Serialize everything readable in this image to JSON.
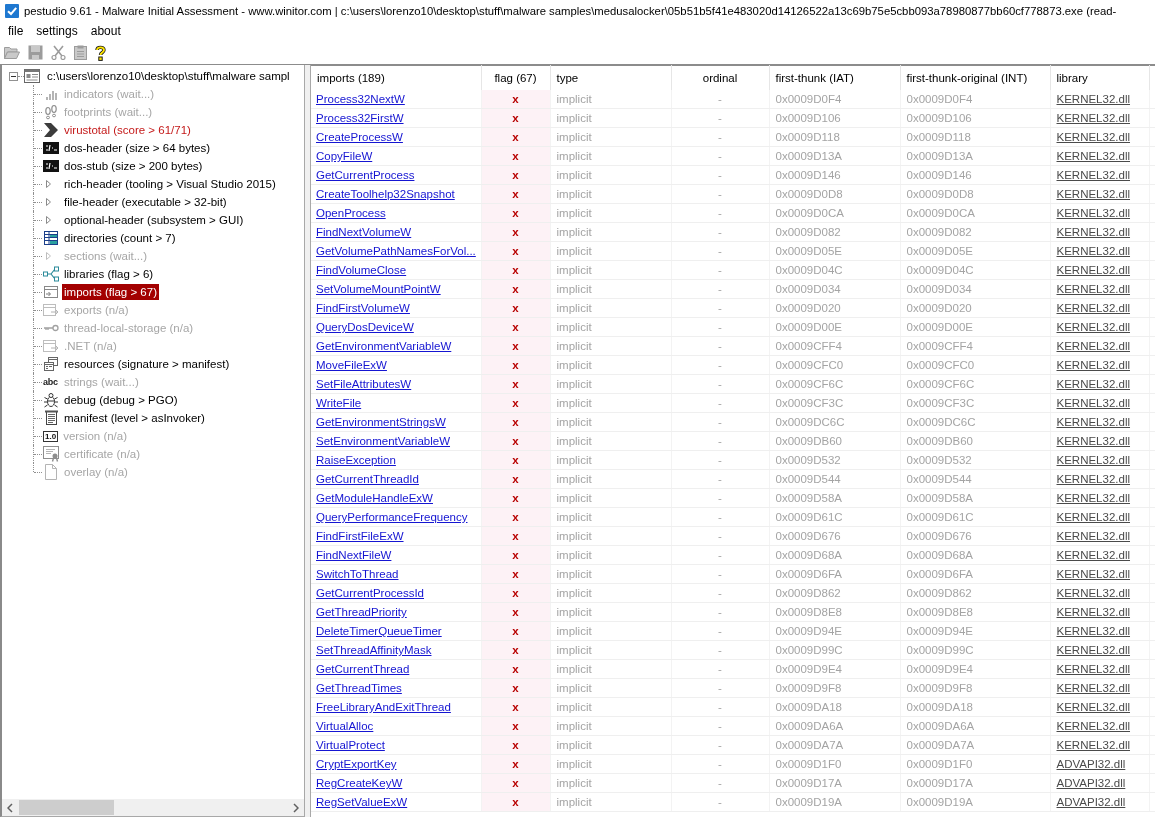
{
  "window": {
    "title": "pestudio 9.61 - Malware Initial Assessment - www.winitor.com | c:\\users\\lorenzo10\\desktop\\stuff\\malware samples\\medusalocker\\05b51b5f41e483020d14126522a13c69b75e5cbb093a78980877bb60cf778873.exe (read-"
  },
  "menu_bar": [
    {
      "label": "file"
    },
    {
      "label": "settings"
    },
    {
      "label": "about"
    }
  ],
  "toolbar": [
    {
      "kind": "open",
      "disabled": true
    },
    {
      "kind": "save",
      "disabled": true
    },
    {
      "kind": "cut",
      "disabled": true
    },
    {
      "kind": "clipboard",
      "disabled": true
    },
    {
      "kind": "help",
      "disabled": false
    }
  ],
  "tree": {
    "label": "c:\\users\\lorenzo10\\desktop\\stuff\\malware sampl",
    "expanded": true,
    "children": [
      {
        "label": "indicators (wait...)",
        "kind": "bars",
        "selected": false,
        "disabled": true,
        "flagged": false
      },
      {
        "label": "footprints (wait...)",
        "kind": "footprints",
        "selected": false,
        "disabled": true,
        "flagged": false
      },
      {
        "label": "virustotal (score > 61/71)",
        "kind": "chevron",
        "selected": false,
        "disabled": false,
        "flagged": true
      },
      {
        "label": "dos-header (size > 64 bytes)",
        "kind": "console",
        "selected": false,
        "disabled": false,
        "flagged": false
      },
      {
        "label": "dos-stub (size > 200 bytes)",
        "kind": "console",
        "selected": false,
        "disabled": false,
        "flagged": false
      },
      {
        "label": "rich-header (tooling > Visual Studio 2015)",
        "kind": "group",
        "expanded": false,
        "selected": false,
        "disabled": false,
        "flagged": false
      },
      {
        "label": "file-header (executable > 32-bit)",
        "kind": "group",
        "expanded": false,
        "selected": false,
        "disabled": false,
        "flagged": false
      },
      {
        "label": "optional-header (subsystem > GUI)",
        "kind": "group",
        "expanded": false,
        "selected": false,
        "disabled": false,
        "flagged": false
      },
      {
        "label": "directories (count > 7)",
        "kind": "grid",
        "selected": false,
        "disabled": false,
        "flagged": false
      },
      {
        "label": "sections (wait...)",
        "kind": "group",
        "expanded": false,
        "selected": false,
        "disabled": true,
        "flagged": false
      },
      {
        "label": "libraries (flag > 6)",
        "kind": "nodes",
        "selected": false,
        "disabled": false,
        "flagged": false
      },
      {
        "label": "imports (flag > 67)",
        "kind": "arrow-in",
        "selected": true,
        "disabled": false,
        "flagged": false
      },
      {
        "label": "exports (n/a)",
        "kind": "arrow-out",
        "selected": false,
        "disabled": true,
        "flagged": false
      },
      {
        "label": "thread-local-storage (n/a)",
        "kind": "key",
        "selected": false,
        "disabled": true,
        "flagged": false
      },
      {
        "label": ".NET (n/a)",
        "kind": "arrow-out",
        "selected": false,
        "disabled": true,
        "flagged": false
      },
      {
        "label": "resources (signature > manifest)",
        "kind": "windows",
        "selected": false,
        "disabled": false,
        "flagged": false
      },
      {
        "label": "strings (wait...)",
        "kind": "glyph",
        "glyph": "abc",
        "selected": false,
        "disabled": true,
        "flagged": false
      },
      {
        "label": "debug (debug > PGO)",
        "kind": "bug",
        "selected": false,
        "disabled": false,
        "flagged": false
      },
      {
        "label": "manifest (level > asInvoker)",
        "kind": "scroll",
        "selected": false,
        "disabled": false,
        "flagged": false
      },
      {
        "label": "version (n/a)",
        "kind": "tag",
        "glyph": "1.0",
        "selected": false,
        "disabled": true,
        "flagged": false
      },
      {
        "label": "certificate (n/a)",
        "kind": "certificate",
        "selected": false,
        "disabled": true,
        "flagged": false
      },
      {
        "label": "overlay (n/a)",
        "kind": "page",
        "selected": false,
        "disabled": true,
        "flagged": false
      }
    ]
  },
  "table": {
    "columns": [
      {
        "label": "imports (189)"
      },
      {
        "label": "flag (67)"
      },
      {
        "label": "type"
      },
      {
        "label": "ordinal"
      },
      {
        "label": "first-thunk (IAT)"
      },
      {
        "label": "first-thunk-original (INT)"
      },
      {
        "label": "library"
      }
    ],
    "rows": [
      {
        "name": "Process32NextW",
        "flag": "x",
        "type": "implicit",
        "ordinal": "-",
        "first_thunk": "0x0009D0F4",
        "first_thunk_original": "0x0009D0F4",
        "library": "KERNEL32.dll"
      },
      {
        "name": "Process32FirstW",
        "flag": "x",
        "type": "implicit",
        "ordinal": "-",
        "first_thunk": "0x0009D106",
        "first_thunk_original": "0x0009D106",
        "library": "KERNEL32.dll"
      },
      {
        "name": "CreateProcessW",
        "flag": "x",
        "type": "implicit",
        "ordinal": "-",
        "first_thunk": "0x0009D118",
        "first_thunk_original": "0x0009D118",
        "library": "KERNEL32.dll"
      },
      {
        "name": "CopyFileW",
        "flag": "x",
        "type": "implicit",
        "ordinal": "-",
        "first_thunk": "0x0009D13A",
        "first_thunk_original": "0x0009D13A",
        "library": "KERNEL32.dll"
      },
      {
        "name": "GetCurrentProcess",
        "flag": "x",
        "type": "implicit",
        "ordinal": "-",
        "first_thunk": "0x0009D146",
        "first_thunk_original": "0x0009D146",
        "library": "KERNEL32.dll"
      },
      {
        "name": "CreateToolhelp32Snapshot",
        "flag": "x",
        "type": "implicit",
        "ordinal": "-",
        "first_thunk": "0x0009D0D8",
        "first_thunk_original": "0x0009D0D8",
        "library": "KERNEL32.dll"
      },
      {
        "name": "OpenProcess",
        "flag": "x",
        "type": "implicit",
        "ordinal": "-",
        "first_thunk": "0x0009D0CA",
        "first_thunk_original": "0x0009D0CA",
        "library": "KERNEL32.dll"
      },
      {
        "name": "FindNextVolumeW",
        "flag": "x",
        "type": "implicit",
        "ordinal": "-",
        "first_thunk": "0x0009D082",
        "first_thunk_original": "0x0009D082",
        "library": "KERNEL32.dll"
      },
      {
        "name": "GetVolumePathNamesForVol...",
        "flag": "x",
        "type": "implicit",
        "ordinal": "-",
        "first_thunk": "0x0009D05E",
        "first_thunk_original": "0x0009D05E",
        "library": "KERNEL32.dll"
      },
      {
        "name": "FindVolumeClose",
        "flag": "x",
        "type": "implicit",
        "ordinal": "-",
        "first_thunk": "0x0009D04C",
        "first_thunk_original": "0x0009D04C",
        "library": "KERNEL32.dll"
      },
      {
        "name": "SetVolumeMountPointW",
        "flag": "x",
        "type": "implicit",
        "ordinal": "-",
        "first_thunk": "0x0009D034",
        "first_thunk_original": "0x0009D034",
        "library": "KERNEL32.dll"
      },
      {
        "name": "FindFirstVolumeW",
        "flag": "x",
        "type": "implicit",
        "ordinal": "-",
        "first_thunk": "0x0009D020",
        "first_thunk_original": "0x0009D020",
        "library": "KERNEL32.dll"
      },
      {
        "name": "QueryDosDeviceW",
        "flag": "x",
        "type": "implicit",
        "ordinal": "-",
        "first_thunk": "0x0009D00E",
        "first_thunk_original": "0x0009D00E",
        "library": "KERNEL32.dll"
      },
      {
        "name": "GetEnvironmentVariableW",
        "flag": "x",
        "type": "implicit",
        "ordinal": "-",
        "first_thunk": "0x0009CFF4",
        "first_thunk_original": "0x0009CFF4",
        "library": "KERNEL32.dll"
      },
      {
        "name": "MoveFileExW",
        "flag": "x",
        "type": "implicit",
        "ordinal": "-",
        "first_thunk": "0x0009CFC0",
        "first_thunk_original": "0x0009CFC0",
        "library": "KERNEL32.dll"
      },
      {
        "name": "SetFileAttributesW",
        "flag": "x",
        "type": "implicit",
        "ordinal": "-",
        "first_thunk": "0x0009CF6C",
        "first_thunk_original": "0x0009CF6C",
        "library": "KERNEL32.dll"
      },
      {
        "name": "WriteFile",
        "flag": "x",
        "type": "implicit",
        "ordinal": "-",
        "first_thunk": "0x0009CF3C",
        "first_thunk_original": "0x0009CF3C",
        "library": "KERNEL32.dll"
      },
      {
        "name": "GetEnvironmentStringsW",
        "flag": "x",
        "type": "implicit",
        "ordinal": "-",
        "first_thunk": "0x0009DC6C",
        "first_thunk_original": "0x0009DC6C",
        "library": "KERNEL32.dll"
      },
      {
        "name": "SetEnvironmentVariableW",
        "flag": "x",
        "type": "implicit",
        "ordinal": "-",
        "first_thunk": "0x0009DB60",
        "first_thunk_original": "0x0009DB60",
        "library": "KERNEL32.dll"
      },
      {
        "name": "RaiseException",
        "flag": "x",
        "type": "implicit",
        "ordinal": "-",
        "first_thunk": "0x0009D532",
        "first_thunk_original": "0x0009D532",
        "library": "KERNEL32.dll"
      },
      {
        "name": "GetCurrentThreadId",
        "flag": "x",
        "type": "implicit",
        "ordinal": "-",
        "first_thunk": "0x0009D544",
        "first_thunk_original": "0x0009D544",
        "library": "KERNEL32.dll"
      },
      {
        "name": "GetModuleHandleExW",
        "flag": "x",
        "type": "implicit",
        "ordinal": "-",
        "first_thunk": "0x0009D58A",
        "first_thunk_original": "0x0009D58A",
        "library": "KERNEL32.dll"
      },
      {
        "name": "QueryPerformanceFrequency",
        "flag": "x",
        "type": "implicit",
        "ordinal": "-",
        "first_thunk": "0x0009D61C",
        "first_thunk_original": "0x0009D61C",
        "library": "KERNEL32.dll"
      },
      {
        "name": "FindFirstFileExW",
        "flag": "x",
        "type": "implicit",
        "ordinal": "-",
        "first_thunk": "0x0009D676",
        "first_thunk_original": "0x0009D676",
        "library": "KERNEL32.dll"
      },
      {
        "name": "FindNextFileW",
        "flag": "x",
        "type": "implicit",
        "ordinal": "-",
        "first_thunk": "0x0009D68A",
        "first_thunk_original": "0x0009D68A",
        "library": "KERNEL32.dll"
      },
      {
        "name": "SwitchToThread",
        "flag": "x",
        "type": "implicit",
        "ordinal": "-",
        "first_thunk": "0x0009D6FA",
        "first_thunk_original": "0x0009D6FA",
        "library": "KERNEL32.dll"
      },
      {
        "name": "GetCurrentProcessId",
        "flag": "x",
        "type": "implicit",
        "ordinal": "-",
        "first_thunk": "0x0009D862",
        "first_thunk_original": "0x0009D862",
        "library": "KERNEL32.dll"
      },
      {
        "name": "GetThreadPriority",
        "flag": "x",
        "type": "implicit",
        "ordinal": "-",
        "first_thunk": "0x0009D8E8",
        "first_thunk_original": "0x0009D8E8",
        "library": "KERNEL32.dll"
      },
      {
        "name": "DeleteTimerQueueTimer",
        "flag": "x",
        "type": "implicit",
        "ordinal": "-",
        "first_thunk": "0x0009D94E",
        "first_thunk_original": "0x0009D94E",
        "library": "KERNEL32.dll"
      },
      {
        "name": "SetThreadAffinityMask",
        "flag": "x",
        "type": "implicit",
        "ordinal": "-",
        "first_thunk": "0x0009D99C",
        "first_thunk_original": "0x0009D99C",
        "library": "KERNEL32.dll"
      },
      {
        "name": "GetCurrentThread",
        "flag": "x",
        "type": "implicit",
        "ordinal": "-",
        "first_thunk": "0x0009D9E4",
        "first_thunk_original": "0x0009D9E4",
        "library": "KERNEL32.dll"
      },
      {
        "name": "GetThreadTimes",
        "flag": "x",
        "type": "implicit",
        "ordinal": "-",
        "first_thunk": "0x0009D9F8",
        "first_thunk_original": "0x0009D9F8",
        "library": "KERNEL32.dll"
      },
      {
        "name": "FreeLibraryAndExitThread",
        "flag": "x",
        "type": "implicit",
        "ordinal": "-",
        "first_thunk": "0x0009DA18",
        "first_thunk_original": "0x0009DA18",
        "library": "KERNEL32.dll"
      },
      {
        "name": "VirtualAlloc",
        "flag": "x",
        "type": "implicit",
        "ordinal": "-",
        "first_thunk": "0x0009DA6A",
        "first_thunk_original": "0x0009DA6A",
        "library": "KERNEL32.dll"
      },
      {
        "name": "VirtualProtect",
        "flag": "x",
        "type": "implicit",
        "ordinal": "-",
        "first_thunk": "0x0009DA7A",
        "first_thunk_original": "0x0009DA7A",
        "library": "KERNEL32.dll"
      },
      {
        "name": "CryptExportKey",
        "flag": "x",
        "type": "implicit",
        "ordinal": "-",
        "first_thunk": "0x0009D1F0",
        "first_thunk_original": "0x0009D1F0",
        "library": "ADVAPI32.dll"
      },
      {
        "name": "RegCreateKeyW",
        "flag": "x",
        "type": "implicit",
        "ordinal": "-",
        "first_thunk": "0x0009D17A",
        "first_thunk_original": "0x0009D17A",
        "library": "ADVAPI32.dll"
      },
      {
        "name": "RegSetValueExW",
        "flag": "x",
        "type": "implicit",
        "ordinal": "-",
        "first_thunk": "0x0009D19A",
        "first_thunk_original": "0x0009D19A",
        "library": "ADVAPI32.dll"
      }
    ]
  }
}
